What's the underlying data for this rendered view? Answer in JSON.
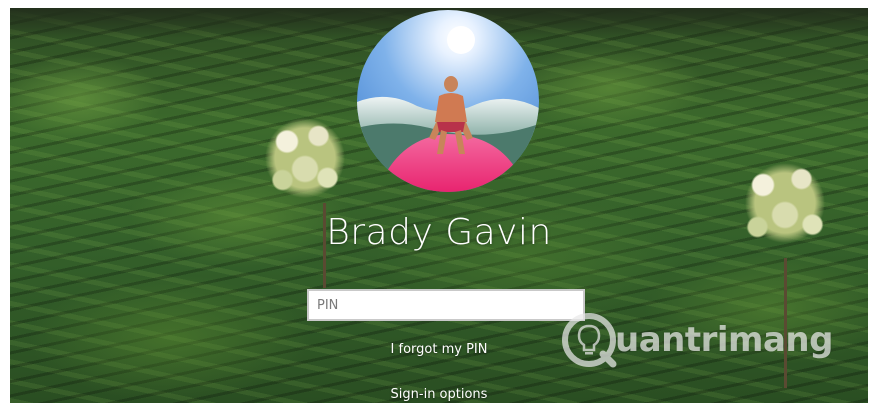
{
  "lock_screen": {
    "user_name": "Brady Gavin",
    "pin_placeholder": "PIN",
    "pin_value": "",
    "forgot_pin_label": "I forgot my PIN",
    "sign_in_options_label": "Sign-in options"
  },
  "watermark": {
    "text": "uantrimang",
    "icon": "lightbulb-q-icon"
  },
  "avatar": {
    "icon": "user-photo"
  },
  "colors": {
    "text": "#ffffff",
    "input_border": "#c9c9c9",
    "input_bg": "#ffffff"
  }
}
